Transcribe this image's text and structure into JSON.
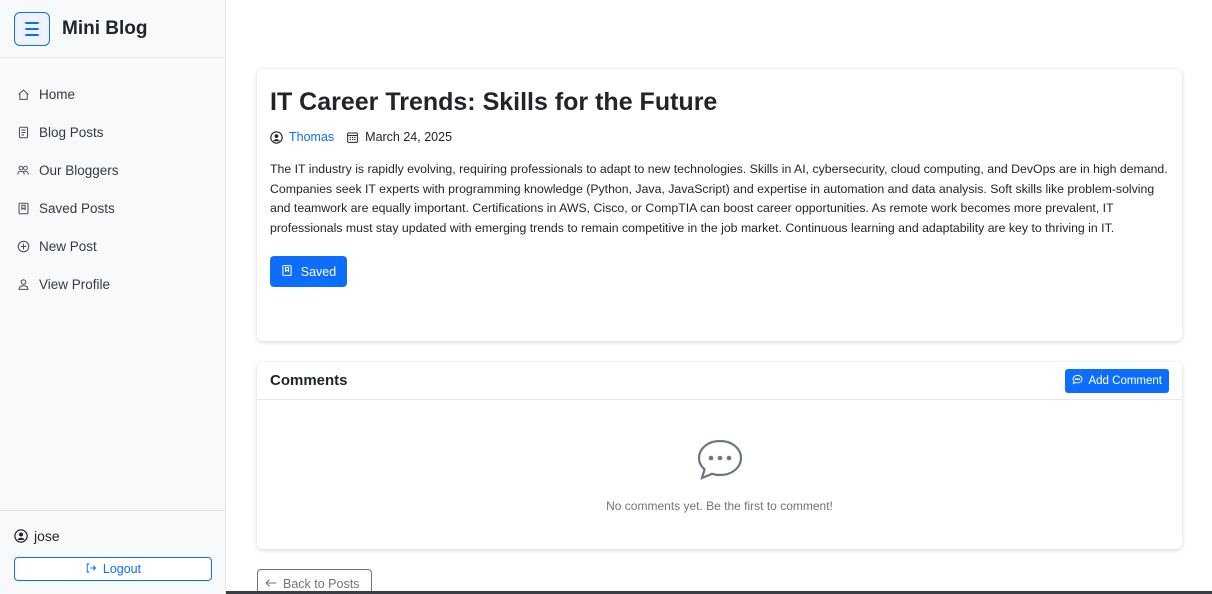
{
  "app": {
    "title": "Mini Blog"
  },
  "sidebar": {
    "items": [
      {
        "label": "Home",
        "icon": "home-icon"
      },
      {
        "label": "Blog Posts",
        "icon": "file-text-icon"
      },
      {
        "label": "Our Bloggers",
        "icon": "people-icon"
      },
      {
        "label": "Saved Posts",
        "icon": "bookmark-icon"
      },
      {
        "label": "New Post",
        "icon": "plus-circle-icon"
      },
      {
        "label": "View Profile",
        "icon": "person-icon"
      }
    ],
    "user": "jose",
    "logout_label": "Logout"
  },
  "post": {
    "title": "IT Career Trends: Skills for the Future",
    "author": "Thomas",
    "date": "March 24, 2025",
    "body": "The IT industry is rapidly evolving, requiring professionals to adapt to new technologies. Skills in AI, cybersecurity, cloud computing, and DevOps are in high demand. Companies seek IT experts with programming knowledge (Python, Java, JavaScript) and expertise in automation and data analysis. Soft skills like problem-solving and teamwork are equally important. Certifications in AWS, Cisco, or CompTIA can boost career opportunities. As remote work becomes more prevalent, IT professionals must stay updated with emerging trends to remain competitive in the job market. Continuous learning and adaptability are key to thriving in IT.",
    "saved_label": "Saved"
  },
  "comments": {
    "title": "Comments",
    "add_label": "Add Comment",
    "empty_text": "No comments yet. Be the first to comment!"
  },
  "back_label": "Back to Posts",
  "colors": {
    "accent": "#0d6efd",
    "sidebar_bg": "#f8f9fa",
    "muted": "#6c757d"
  }
}
